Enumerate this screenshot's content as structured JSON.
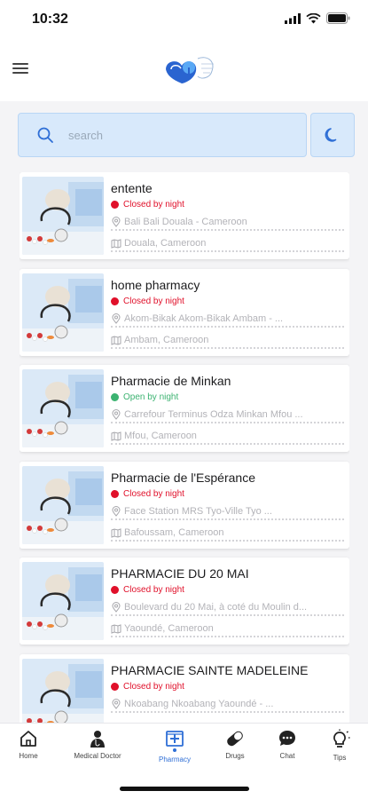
{
  "status_bar": {
    "time": "10:32"
  },
  "search": {
    "placeholder": "search"
  },
  "colors": {
    "accent": "#2f6fd6",
    "closed": "#e0102a",
    "open": "#3cb371"
  },
  "pharmacies": [
    {
      "name": "entente",
      "status": "Closed by night",
      "state": "closed",
      "address": "Bali Bali Douala - Cameroon",
      "city": "Douala, Cameroon"
    },
    {
      "name": "home pharmacy",
      "status": "Closed by night",
      "state": "closed",
      "address": "Akom-Bikak Akom-Bikak Ambam - ...",
      "city": "Ambam, Cameroon"
    },
    {
      "name": "Pharmacie de Minkan",
      "status": "Open by night",
      "state": "open",
      "address": "Carrefour Terminus Odza Minkan Mfou ...",
      "city": "Mfou, Cameroon"
    },
    {
      "name": "Pharmacie de l'Espérance",
      "status": "Closed by night",
      "state": "closed",
      "address": "Face Station MRS Tyo-Ville Tyo ...",
      "city": "Bafoussam, Cameroon"
    },
    {
      "name": "PHARMACIE DU 20 MAI",
      "status": "Closed by night",
      "state": "closed",
      "address": "Boulevard du 20 Mai, à coté du Moulin d...",
      "city": "Yaoundé, Cameroon"
    },
    {
      "name": "PHARMACIE SAINTE MADELEINE",
      "status": "Closed by night",
      "state": "closed",
      "address": "Nkoabang Nkoabang Yaoundé - ...",
      "city": ""
    }
  ],
  "tabs": [
    {
      "label": "Home",
      "icon": "home-icon"
    },
    {
      "label": "Medical Doctor",
      "icon": "doctor-icon"
    },
    {
      "label": "Pharmacy",
      "icon": "pharmacy-icon",
      "active": true
    },
    {
      "label": "Drugs",
      "icon": "pill-icon"
    },
    {
      "label": "Chat",
      "icon": "chat-icon"
    },
    {
      "label": "Tips",
      "icon": "lightbulb-icon"
    }
  ]
}
